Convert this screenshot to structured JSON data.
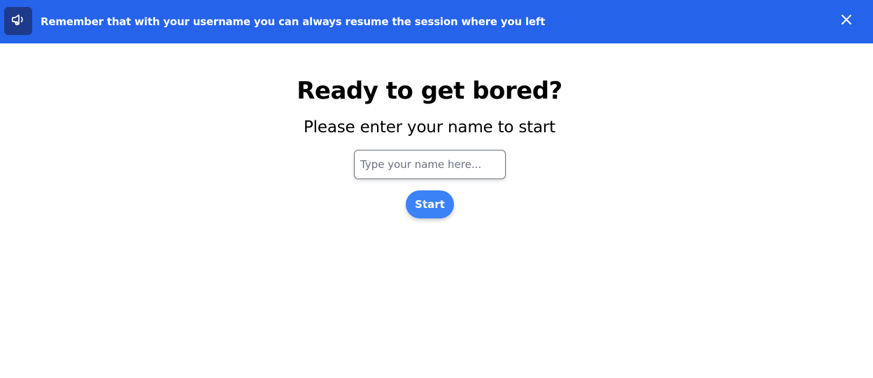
{
  "banner": {
    "icon": "megaphone-icon",
    "message": "Remember that with your username you can always resume the session where you left",
    "close_icon": "close-icon",
    "background_color": "#2563eb",
    "icon_box_color": "#1e3a8a"
  },
  "main": {
    "title": "Ready to get bored?",
    "subtitle": "Please enter your name to start",
    "name_input": {
      "value": "",
      "placeholder": "Type your name here..."
    },
    "start_button_label": "Start",
    "button_color": "#3b82f6"
  }
}
